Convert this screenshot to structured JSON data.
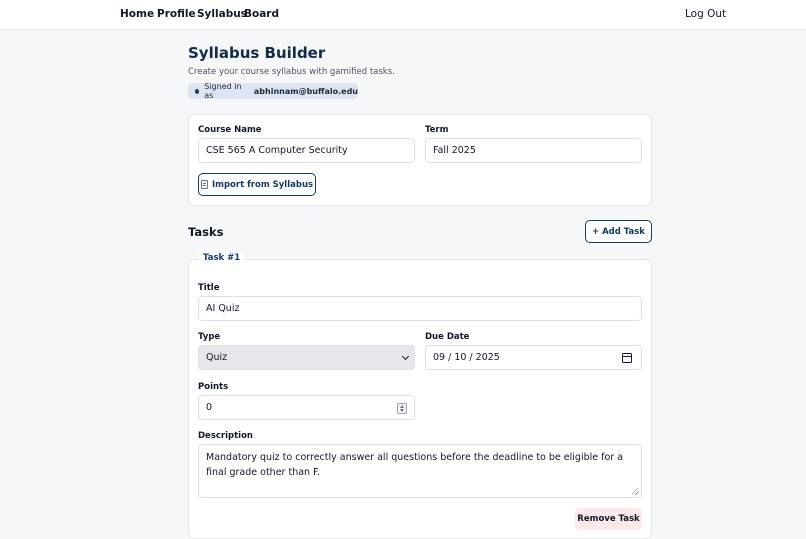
{
  "nav": {
    "items": [
      {
        "label": "Home"
      },
      {
        "label": "Profile"
      },
      {
        "label": "Syllabus"
      },
      {
        "label": "Board"
      }
    ],
    "logout_label": "Log Out"
  },
  "header": {
    "title": "Syllabus Builder",
    "subtitle": "Create your course syllabus with gamified tasks.",
    "signed_in_prefix": "Signed in as",
    "email": "abhinnam@buffalo.edu"
  },
  "course": {
    "name_label": "Course Name",
    "name_value": "CSE 565 A Computer Security",
    "term_label": "Term",
    "term_value": "Fall 2025",
    "import_label": "Import from Syllabus",
    "import_icon": "document-icon"
  },
  "tasks": {
    "heading": "Tasks",
    "add_label": "+ Add Task",
    "items": [
      {
        "legend": "Task #1",
        "title_label": "Title",
        "title_value": "AI Quiz",
        "type_label": "Type",
        "type_value": "Quiz",
        "due_label": "Due Date",
        "due_value": "09 / 10 / 2025",
        "points_label": "Points",
        "points_value": "0",
        "description_label": "Description",
        "description_value": "Mandatory quiz to correctly answer all questions before the deadline to be eligible for a final grade other than F.",
        "remove_label": "Remove Task"
      }
    ]
  },
  "colors": {
    "accent": "#0f3b6f",
    "danger_bg": "#fde8e8",
    "page_bg": "#f6f7f9"
  }
}
